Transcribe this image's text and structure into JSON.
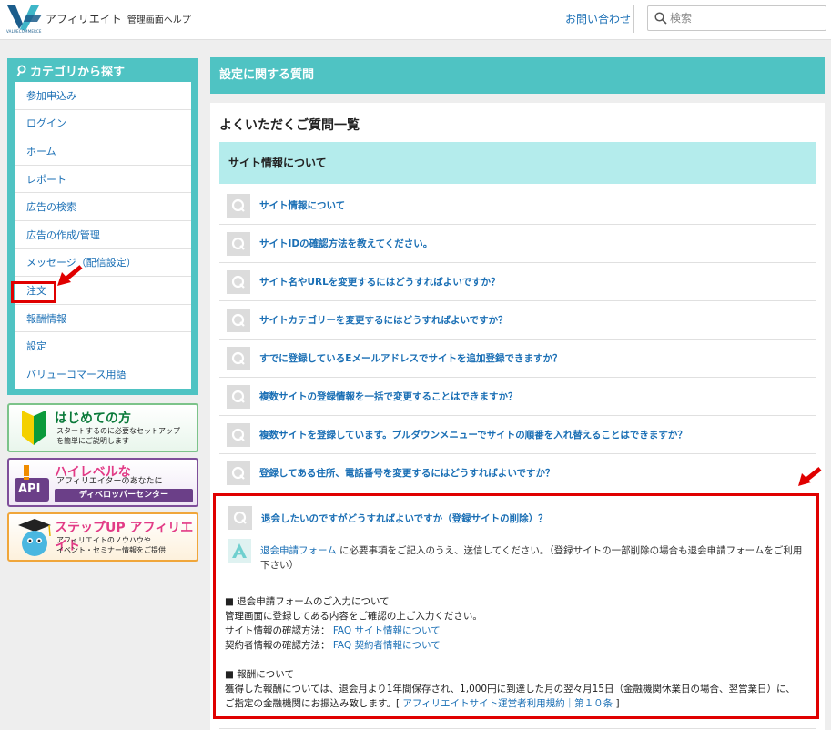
{
  "header": {
    "brand": "アフィリエイト",
    "brand_sub": "管理画面ヘルプ",
    "logo_sub": "VALUECOMMERCE",
    "contact": "お問い合わせ",
    "search_placeholder": "検索"
  },
  "sidebar": {
    "title": "カテゴリから探す",
    "items": [
      {
        "label": "参加申込み"
      },
      {
        "label": "ログイン"
      },
      {
        "label": "ホーム"
      },
      {
        "label": "レポート"
      },
      {
        "label": "広告の検索"
      },
      {
        "label": "広告の作成/管理"
      },
      {
        "label": "メッセージ（配信設定）"
      },
      {
        "label": "注文"
      },
      {
        "label": "報酬情報"
      },
      {
        "label": "設定"
      },
      {
        "label": "バリューコマース用語"
      }
    ],
    "banners": [
      {
        "title": "はじめての方",
        "desc1": "スタートするのに必要なセットアップ",
        "desc2": "を簡単にご説明します"
      },
      {
        "title": "ハイレベルな",
        "desc1": "アフィリエイターのあなたに",
        "pill": "ディベロッパーセンター",
        "badge": "API"
      },
      {
        "title": "ステップUP アフィリエイト",
        "desc1": "アフィリエイトのノウハウや",
        "desc2": "イベント・セミナー情報をご提供"
      }
    ]
  },
  "main": {
    "header": "設定に関する質問",
    "faq_title": "よくいただくご質問一覧",
    "section": "サイト情報について",
    "questions": [
      {
        "text": "サイト情報について"
      },
      {
        "text": "サイトIDの確認方法を教えてください。"
      },
      {
        "text": "サイト名やURLを変更するにはどうすればよいですか？"
      },
      {
        "text": "サイトカテゴリーを変更するにはどうすればよいですか？"
      },
      {
        "text": "すでに登録しているEメールアドレスでサイトを追加登録できますか？"
      },
      {
        "text": "複数サイトの登録情報を一括で変更することはできますか？"
      },
      {
        "text": "複数サイトを登録しています。プルダウンメニューでサイトの順番を入れ替えることはできますか？"
      },
      {
        "text": "登録してある住所、電話番号を変更するにはどうすればよいですか？"
      }
    ],
    "answer": {
      "question": "退会したいのですがどうすればよいですか（登録サイトの削除）？",
      "link1": "退会申請フォーム",
      "text1": " に必要事項をご記入のうえ、送信してください。（登録サイトの一部削除の場合も退会申請フォームをご利用下さい）",
      "s1_title": "■ 退会申請フォームのご入力について",
      "s1_line1": "管理画面に登録してある内容をご確認の上ご入力ください。",
      "s1_line2_label": "サイト情報の確認方法：",
      "s1_line2_link": "FAQ サイト情報について",
      "s1_line3_label": "契約者情報の確認方法：",
      "s1_line3_link": "FAQ 契約者情報について",
      "s2_title": "■ 報酬について",
      "s2_line1": "獲得した報酬については、退会月より1年間保存され、1,000円に到達した月の翌々月15日（金融機関休業日の場合、翌営業日）に、",
      "s2_line2_pre": "ご指定の金融機関にお振込み致します。[ ",
      "s2_line2_link": "アフィリエイトサイト運営者利用規約｜第１０条",
      "s2_line2_post": " ]"
    }
  },
  "colors": {
    "teal": "#4fc3c3",
    "section_bg": "#b4ecec",
    "link": "#1a6fb5",
    "highlight": "#e00000"
  }
}
